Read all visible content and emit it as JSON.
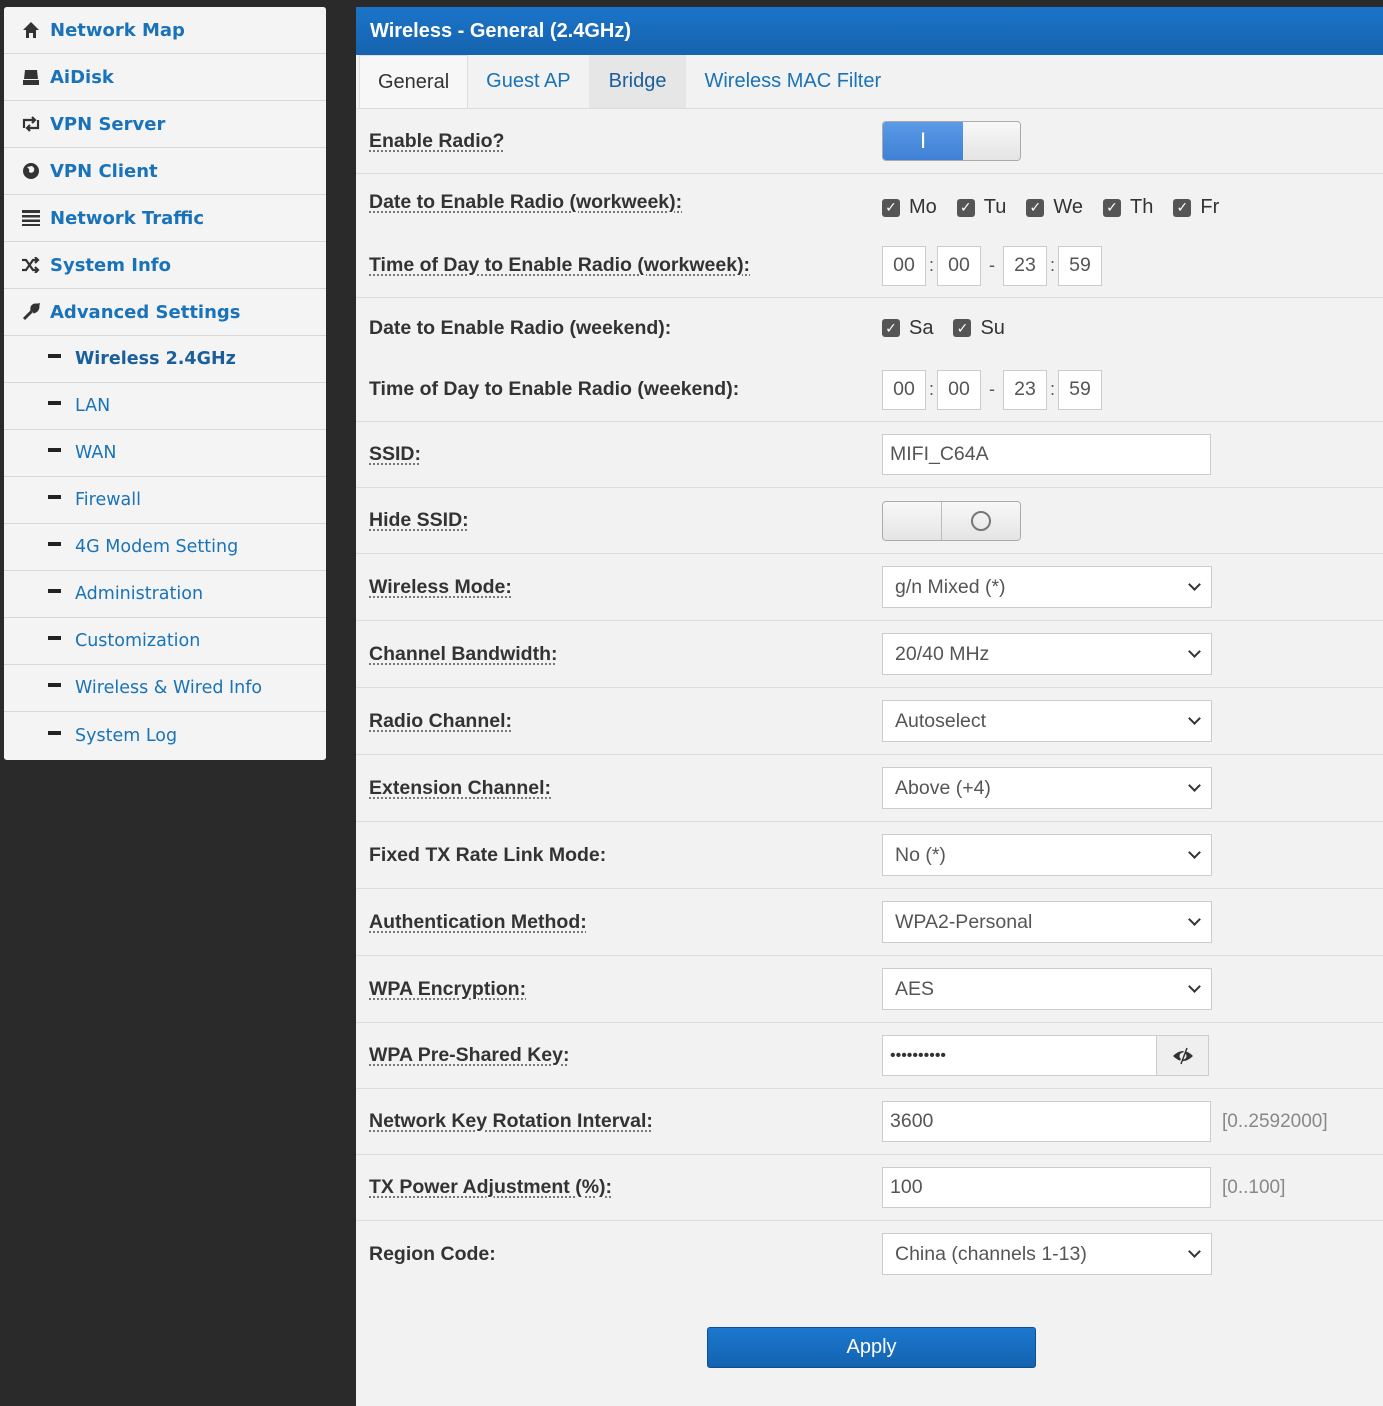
{
  "sidebar": {
    "items": [
      {
        "label": "Network Map",
        "icon": "home-icon"
      },
      {
        "label": "AiDisk",
        "icon": "disk-icon"
      },
      {
        "label": "VPN Server",
        "icon": "sync-icon"
      },
      {
        "label": "VPN Client",
        "icon": "globe-icon"
      },
      {
        "label": "Network Traffic",
        "icon": "list-icon"
      },
      {
        "label": "System Info",
        "icon": "shuffle-icon"
      },
      {
        "label": "Advanced Settings",
        "icon": "wrench-icon"
      }
    ],
    "subitems": [
      {
        "label": "Wireless 2.4GHz"
      },
      {
        "label": "LAN"
      },
      {
        "label": "WAN"
      },
      {
        "label": "Firewall"
      },
      {
        "label": "4G Modem Setting"
      },
      {
        "label": "Administration"
      },
      {
        "label": "Customization"
      },
      {
        "label": "Wireless & Wired Info"
      },
      {
        "label": "System Log"
      }
    ]
  },
  "header": {
    "title": "Wireless - General (2.4GHz)"
  },
  "tabs": [
    "General",
    "Guest AP",
    "Bridge",
    "Wireless MAC Filter"
  ],
  "form": {
    "enable_radio": {
      "label": "Enable Radio?",
      "on_label": "I",
      "value": true
    },
    "workweek_days": {
      "label": "Date to Enable Radio (workweek):",
      "days": [
        "Mo",
        "Tu",
        "We",
        "Th",
        "Fr"
      ]
    },
    "workweek_time": {
      "label": "Time of Day to Enable Radio (workweek):",
      "start_h": "00",
      "start_m": "00",
      "end_h": "23",
      "end_m": "59",
      "colon": ":",
      "dash": "-"
    },
    "weekend_days": {
      "label": "Date to Enable Radio (weekend):",
      "days": [
        "Sa",
        "Su"
      ]
    },
    "weekend_time": {
      "label": "Time of Day to Enable Radio (weekend):",
      "start_h": "00",
      "start_m": "00",
      "end_h": "23",
      "end_m": "59"
    },
    "ssid": {
      "label": "SSID:",
      "value": "MIFI_C64A"
    },
    "hide_ssid": {
      "label": "Hide SSID:",
      "value": false
    },
    "wireless_mode": {
      "label": "Wireless Mode:",
      "value": "g/n Mixed (*)"
    },
    "channel_bandwidth": {
      "label": "Channel Bandwidth:",
      "value": "20/40 MHz"
    },
    "radio_channel": {
      "label": "Radio Channel:",
      "value": "Autoselect"
    },
    "extension_channel": {
      "label": "Extension Channel:",
      "value": "Above (+4)"
    },
    "fixed_tx": {
      "label": "Fixed TX Rate Link Mode:",
      "value": "No (*)"
    },
    "auth_method": {
      "label": "Authentication Method:",
      "value": "WPA2-Personal"
    },
    "wpa_encryption": {
      "label": "WPA Encryption:",
      "value": "AES"
    },
    "wpa_psk": {
      "label": "WPA Pre-Shared Key:",
      "value": "••••••••••"
    },
    "key_rotation": {
      "label": "Network Key Rotation Interval:",
      "value": "3600",
      "hint": "[0..2592000]"
    },
    "tx_power": {
      "label": "TX Power Adjustment (%):",
      "value": "100",
      "hint": "[0..100]"
    },
    "region_code": {
      "label": "Region Code:",
      "value": "China (channels 1-13)"
    }
  },
  "apply_label": "Apply",
  "colors": {
    "accent": "#1a73b8",
    "header": "#1663ae"
  }
}
